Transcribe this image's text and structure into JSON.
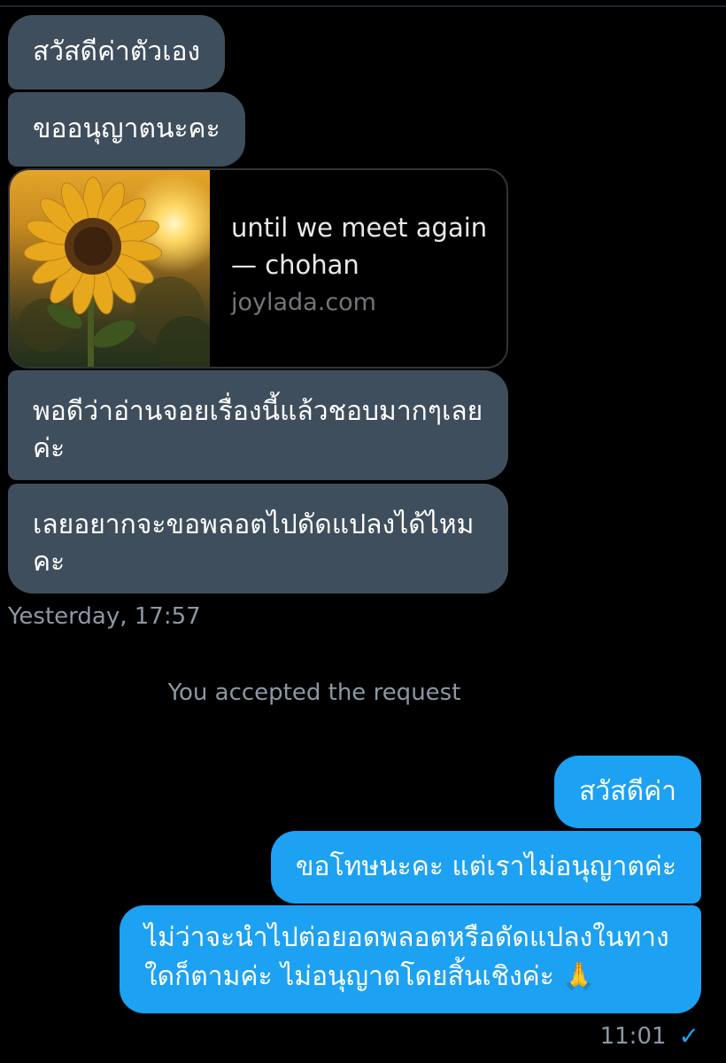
{
  "incoming": {
    "msg1": "สวัสดีค่าตัวเอง",
    "msg2": "ขออนุญาตนะคะ",
    "link_card": {
      "title_line1": "until we meet again",
      "title_line2": "— chohan",
      "domain": "joylada.com",
      "image": "sunflower-photo"
    },
    "msg4_line1": "พอดีว่าอ่านจอยเรื่องนี้แล้วชอบมากๆเลย",
    "msg4_line2": "ค่ะ",
    "msg5_line1": "เลยอยากจะขอพลอตไปดัดแปลงได้ไหม",
    "msg5_line2": "คะ",
    "timestamp": "Yesterday, 17:57"
  },
  "system": {
    "notice": "You accepted the request"
  },
  "outgoing": {
    "msg1": "สวัสดีค่า",
    "msg2": "ขอโทษนะคะ แต่เราไม่อนุญาตค่ะ",
    "msg3_line1": "ไม่ว่าจะนำไปต่อยอดพลอตหรือดัดแปลงในทาง",
    "msg3_line2": "ใดก็ตามค่ะ ไม่อนุญาตโดยสิ้นเชิงค่ะ 🙏",
    "timestamp": "11:01",
    "status_icon": "read-check-icon"
  },
  "colors": {
    "incoming_bubble": "#3f4e5c",
    "outgoing_bubble": "#1da1f2",
    "background": "#000000",
    "meta_text": "#8b98a5"
  }
}
